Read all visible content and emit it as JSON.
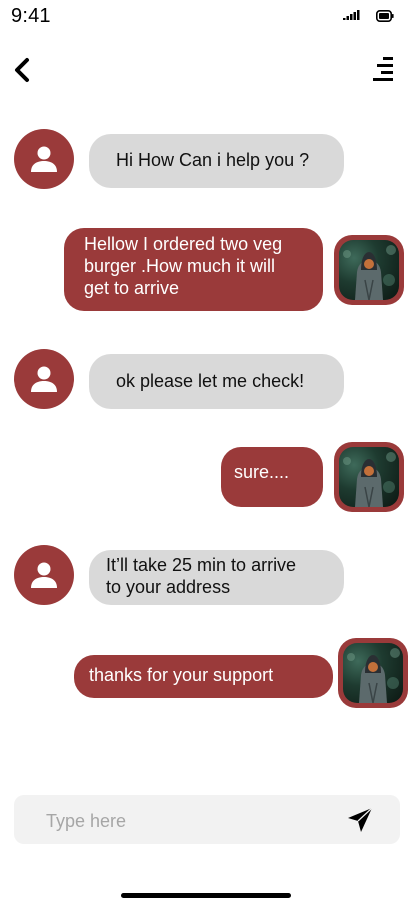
{
  "status_bar": {
    "time": "9:41",
    "icons": [
      "signal-icon",
      "battery-icon"
    ]
  },
  "header": {
    "back_icon": "chevron-left-icon",
    "menu_icon": "menu-icon"
  },
  "messages": [
    {
      "sender": "support",
      "text": "Hi How Can i help you ?"
    },
    {
      "sender": "user",
      "lines": [
        "Hellow I ordered two veg",
        "burger .How much it will",
        "get to arrive"
      ]
    },
    {
      "sender": "support",
      "text": "ok please let me check!"
    },
    {
      "sender": "user",
      "text": "sure...."
    },
    {
      "sender": "support",
      "lines": [
        "It’ll take 25 min to arrive",
        "to your address"
      ]
    },
    {
      "sender": "user",
      "text": "thanks for your support"
    }
  ],
  "composer": {
    "placeholder": "Type here",
    "send_icon": "send-icon"
  },
  "colors": {
    "accent": "#9a3a3a",
    "bot_bubble": "#d9d9d9",
    "input_bg": "#f2f2f2"
  }
}
